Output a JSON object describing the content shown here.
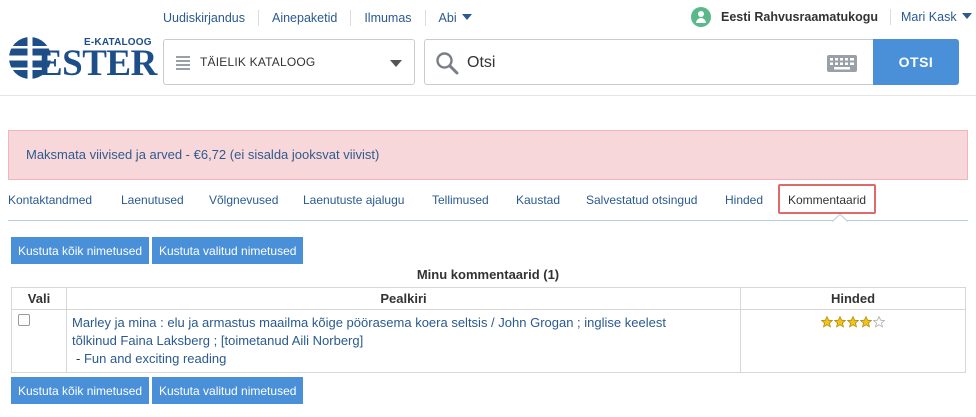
{
  "header": {
    "nav": [
      {
        "label": "Uudiskirjandus"
      },
      {
        "label": "Ainepaketid"
      },
      {
        "label": "Ilmumas"
      },
      {
        "label": "Abi"
      }
    ],
    "library": "Eesti Rahvusraamatukogu",
    "user": "Mari Kask"
  },
  "logo": {
    "subtitle": "E-KATALOOG",
    "name": "ESTER"
  },
  "search": {
    "catalog_label": "TÄIELIK KATALOOG",
    "query_placeholder": "Otsi",
    "button_label": "OTSI"
  },
  "alert": {
    "text": "Maksmata viivised ja arved - €6,72 (ei sisalda jooksvat viivist)"
  },
  "tabs": [
    {
      "label": "Kontaktandmed"
    },
    {
      "label": "Laenutused"
    },
    {
      "label": "Võlgnevused"
    },
    {
      "label": "Laenutuste ajalugu"
    },
    {
      "label": "Tellimused"
    },
    {
      "label": "Kaustad"
    },
    {
      "label": "Salvestatud otsingud"
    },
    {
      "label": "Hinded"
    },
    {
      "label": "Kommentaarid",
      "active": true
    }
  ],
  "actions": {
    "delete_all": "Kustuta kõik nimetused",
    "delete_selected": "Kustuta valitud nimetused"
  },
  "table": {
    "title": "Minu kommentaarid (1)",
    "headers": {
      "select": "Vali",
      "title": "Pealkiri",
      "grade": "Hinded"
    },
    "rows": [
      {
        "title_line1": "Marley ja mina : elu ja armastus maailma kõige pöörasema koera seltsis / John Grogan ; inglise keelest",
        "title_line2": "tõlkinud Faina Laksberg ; [toimetanud Aili Norberg]",
        "comment_prefix": "- ",
        "comment": "Fun and exciting reading",
        "rating": 4,
        "rating_max": 5
      }
    ]
  },
  "colors": {
    "accent": "#4a90d9",
    "link": "#2a5a8f",
    "alert_bg": "#f8d7da",
    "active_tab_border": "#e06a6a",
    "star": "#f0c419"
  }
}
